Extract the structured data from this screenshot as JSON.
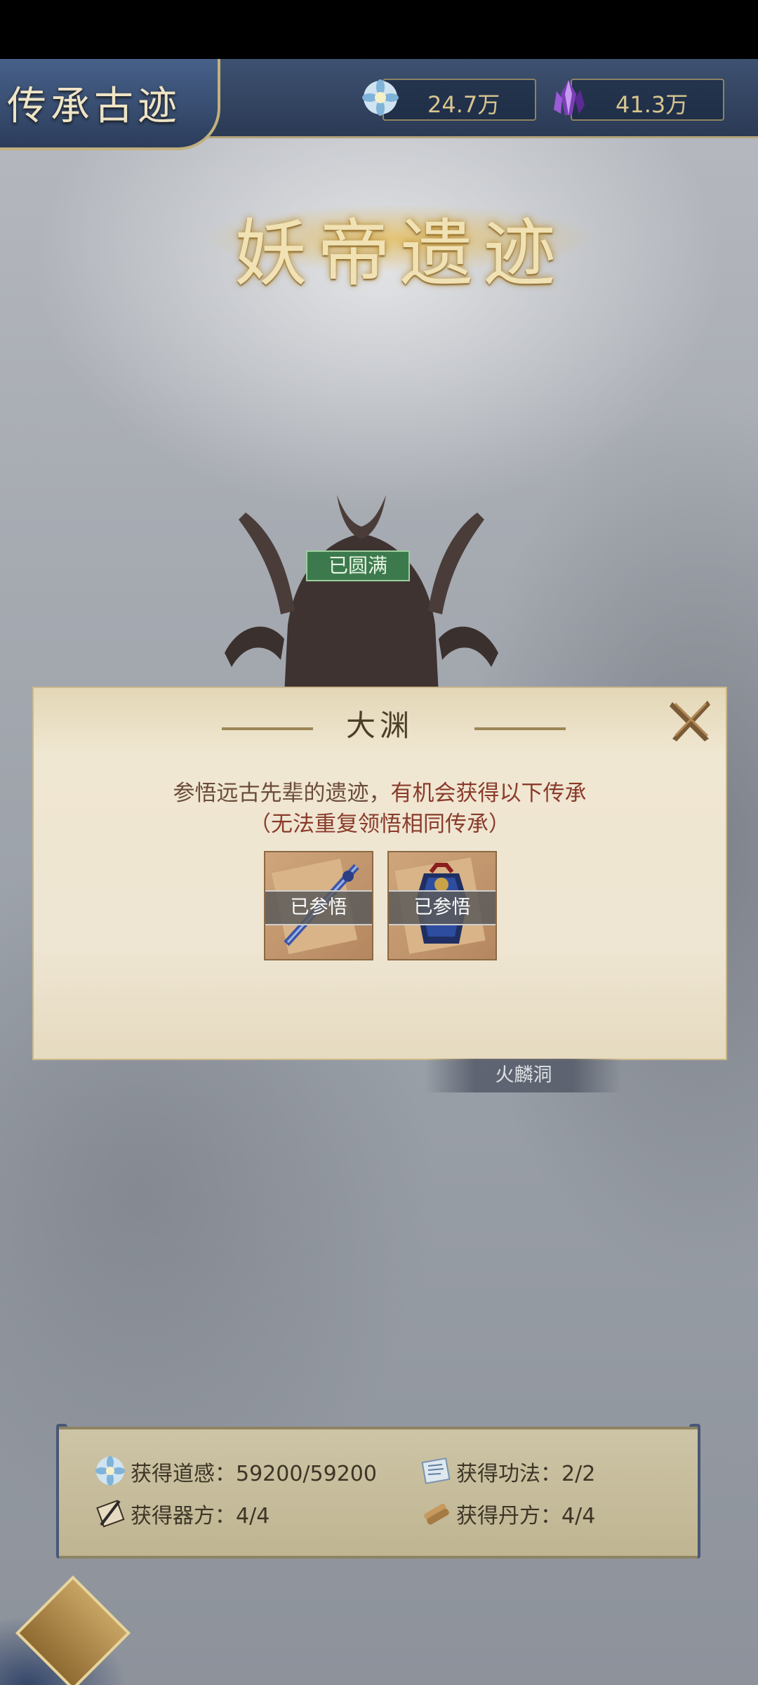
{
  "header": {
    "title": "传承古迹",
    "resources": [
      {
        "icon": "lotus-icon",
        "value": "24.7万"
      },
      {
        "icon": "purple-crystal-icon",
        "value": "41.3万"
      }
    ]
  },
  "main": {
    "big_title": "妖帝遗迹",
    "status_badge": "已圆满",
    "location_label": "火麟洞"
  },
  "modal": {
    "title": "大渊",
    "description_part1": "参悟远古先辈的遗迹，",
    "description_part2": "有机会获得以下传承",
    "note": "（无法重复领悟相同传承）",
    "items": [
      {
        "icon": "sword-scroll-icon",
        "tag": "已参悟"
      },
      {
        "icon": "armor-scroll-icon",
        "tag": "已参悟"
      }
    ]
  },
  "stats": {
    "dao_sense": {
      "icon": "lotus-icon",
      "text": "获得道感：59200/59200"
    },
    "techniques": {
      "icon": "scroll-map-icon",
      "text": "获得功法：2/2"
    },
    "artifact_recipes": {
      "icon": "artifact-scroll-icon",
      "text": "获得器方：4/4"
    },
    "pill_recipes": {
      "icon": "pill-scroll-icon",
      "text": "获得丹方：4/4"
    }
  },
  "colors": {
    "header_bg": "#2b3a55",
    "accent_gold": "#c2b07e",
    "badge_green": "#3c7a4d",
    "text_red": "#8a3b2b"
  }
}
